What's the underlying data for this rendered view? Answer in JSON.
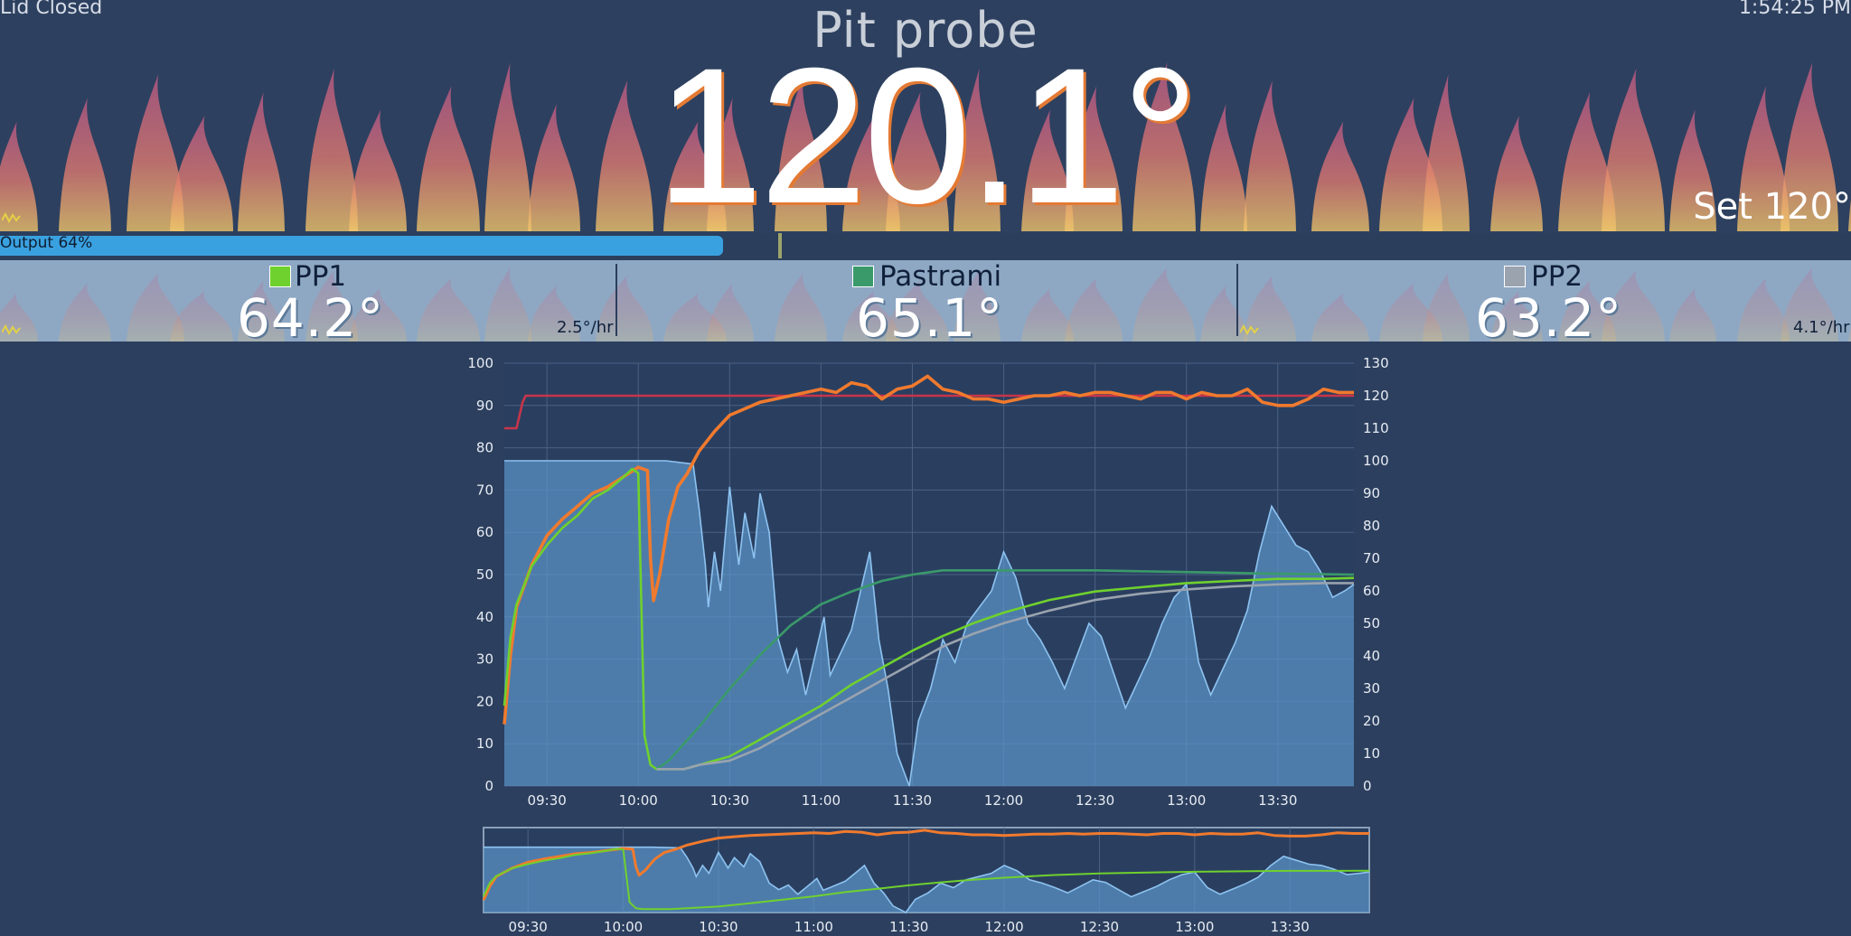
{
  "header": {
    "lid_status": "Lid Closed",
    "clock": "1:54:25 PM",
    "pit_name": "Pit probe",
    "pit_temp": "120.1°",
    "setpoint": "Set 120°",
    "output_label": "Output 64%",
    "output_percent": 64
  },
  "probes": [
    {
      "name": "PP1",
      "temp": "64.2°",
      "rate": "2.5°/hr",
      "color": "#6fd12d"
    },
    {
      "name": "Pastrami",
      "temp": "65.1°",
      "rate": "",
      "color": "#3a9a6a"
    },
    {
      "name": "PP2",
      "temp": "63.2°",
      "rate": "4.1°/hr",
      "color": "#9aa3ae"
    }
  ],
  "colors": {
    "background": "#2c3f5e",
    "pit_line": "#f07a2e",
    "setpoint_line": "#c8344a",
    "fan_area": "#5b94c8"
  },
  "chart_data": [
    {
      "type": "line",
      "title": "",
      "left_axis": {
        "ylim": [
          0,
          100
        ],
        "ticks": [
          0,
          10,
          20,
          30,
          40,
          50,
          60,
          70,
          80,
          90,
          100
        ]
      },
      "right_axis": {
        "ylim": [
          0,
          130
        ],
        "ticks": [
          0,
          10,
          20,
          30,
          40,
          50,
          60,
          70,
          80,
          90,
          100,
          110,
          120,
          130
        ]
      },
      "x_ticks": [
        "09:30",
        "10:00",
        "10:30",
        "11:00",
        "11:30",
        "12:00",
        "12:30",
        "13:00",
        "13:30"
      ],
      "xlim": [
        "09:16",
        "13:55"
      ],
      "grid": true,
      "series": [
        {
          "axis": "right",
          "color": "#5b94c8",
          "area": true,
          "x": [
            "09:16",
            "10:09",
            "10:18",
            "10:20",
            "10:22",
            "10:23",
            "10:25",
            "10:27",
            "10:30",
            "10:33",
            "10:35",
            "10:38",
            "10:40",
            "10:43",
            "10:46",
            "10:49",
            "10:52",
            "10:55",
            "10:58",
            "11:01",
            "11:03",
            "11:06",
            "11:10",
            "11:13",
            "11:16",
            "11:19",
            "11:22",
            "11:25",
            "11:29",
            "11:32",
            "11:36",
            "11:40",
            "11:44",
            "11:48",
            "11:52",
            "11:56",
            "12:00",
            "12:04",
            "12:08",
            "12:12",
            "12:16",
            "12:20",
            "12:24",
            "12:28",
            "12:32",
            "12:36",
            "12:40",
            "12:44",
            "12:48",
            "12:52",
            "12:56",
            "13:00",
            "13:04",
            "13:08",
            "13:12",
            "13:16",
            "13:20",
            "13:24",
            "13:28",
            "13:32",
            "13:36",
            "13:40",
            "13:44",
            "13:48",
            "13:52",
            "13:55"
          ],
          "values": [
            100,
            100,
            99,
            85,
            68,
            55,
            72,
            60,
            92,
            68,
            84,
            70,
            90,
            78,
            45,
            35,
            42,
            28,
            40,
            52,
            34,
            40,
            48,
            60,
            72,
            45,
            30,
            10,
            0,
            20,
            30,
            45,
            38,
            50,
            55,
            60,
            72,
            64,
            50,
            45,
            38,
            30,
            40,
            50,
            46,
            35,
            24,
            32,
            40,
            50,
            58,
            62,
            38,
            28,
            36,
            44,
            54,
            72,
            86,
            80,
            74,
            72,
            66,
            58,
            60,
            62
          ]
        },
        {
          "axis": "right",
          "color": "#c8344a",
          "x": [
            "09:16",
            "09:20",
            "09:22",
            "09:23",
            "13:55"
          ],
          "values": [
            110,
            110,
            118,
            120,
            120
          ]
        },
        {
          "axis": "right",
          "color": "#f07a2e",
          "x": [
            "09:16",
            "09:18",
            "09:20",
            "09:25",
            "09:30",
            "09:35",
            "09:40",
            "09:45",
            "09:50",
            "09:55",
            "10:00",
            "10:03",
            "10:04",
            "10:05",
            "10:07",
            "10:10",
            "10:13",
            "10:16",
            "10:20",
            "10:25",
            "10:30",
            "10:35",
            "10:40",
            "10:45",
            "10:50",
            "10:55",
            "11:00",
            "11:05",
            "11:10",
            "11:15",
            "11:20",
            "11:25",
            "11:30",
            "11:35",
            "11:40",
            "11:45",
            "11:50",
            "11:55",
            "12:00",
            "12:05",
            "12:10",
            "12:15",
            "12:20",
            "12:25",
            "12:30",
            "12:35",
            "12:40",
            "12:45",
            "12:50",
            "12:55",
            "13:00",
            "13:05",
            "13:10",
            "13:15",
            "13:20",
            "13:25",
            "13:30",
            "13:35",
            "13:40",
            "13:45",
            "13:50",
            "13:55"
          ],
          "values": [
            19,
            40,
            55,
            68,
            77,
            82,
            86,
            90,
            92,
            95,
            98,
            97,
            70,
            57,
            65,
            82,
            92,
            96,
            103,
            109,
            114,
            116,
            118,
            119,
            120,
            121,
            122,
            121,
            124,
            123,
            119,
            122,
            123,
            126,
            122,
            121,
            119,
            119,
            118,
            119,
            120,
            120,
            121,
            120,
            121,
            121,
            120,
            119,
            121,
            121,
            119,
            121,
            120,
            120,
            122,
            118,
            117,
            117,
            119,
            122,
            121,
            121
          ]
        },
        {
          "axis": "left",
          "color": "#6fd12d",
          "x": [
            "09:16",
            "09:18",
            "09:20",
            "09:25",
            "09:30",
            "09:35",
            "09:40",
            "09:45",
            "09:50",
            "09:55",
            "09:58",
            "10:00",
            "10:02",
            "10:04",
            "10:06",
            "10:08",
            "10:15",
            "10:20",
            "10:30",
            "10:40",
            "10:50",
            "11:00",
            "11:10",
            "11:20",
            "11:30",
            "11:40",
            "11:50",
            "12:00",
            "12:15",
            "12:30",
            "12:45",
            "13:00",
            "13:15",
            "13:30",
            "13:45",
            "13:55"
          ],
          "values": [
            19,
            35,
            43,
            52,
            57,
            61,
            64,
            68,
            70,
            73,
            75,
            74,
            12,
            5,
            4,
            4,
            4,
            5,
            7,
            11,
            15,
            19,
            24,
            28,
            32,
            35.5,
            38.5,
            41,
            44,
            46,
            47,
            48,
            48.5,
            49,
            49,
            49.2
          ]
        },
        {
          "axis": "left",
          "color": "#3a9a6a",
          "x": [
            "10:06",
            "10:10",
            "10:20",
            "10:30",
            "10:40",
            "10:50",
            "11:00",
            "11:10",
            "11:20",
            "11:30",
            "11:40",
            "11:50",
            "12:00",
            "12:15",
            "12:30",
            "12:45",
            "13:00",
            "13:15",
            "13:30",
            "13:45",
            "13:55"
          ],
          "values": [
            4,
            6,
            14,
            23,
            31,
            38,
            43,
            46,
            48.5,
            50,
            51,
            51,
            51,
            51,
            51,
            50.8,
            50.6,
            50.4,
            50.2,
            50.1,
            50
          ]
        },
        {
          "axis": "left",
          "color": "#9aa3ae",
          "x": [
            "10:06",
            "10:15",
            "10:20",
            "10:30",
            "10:40",
            "10:50",
            "11:00",
            "11:10",
            "11:20",
            "11:30",
            "11:40",
            "11:50",
            "12:00",
            "12:15",
            "12:30",
            "12:45",
            "13:00",
            "13:15",
            "13:30",
            "13:45",
            "13:55"
          ],
          "values": [
            4,
            4,
            5,
            6,
            9,
            13,
            17,
            21,
            25,
            29,
            33,
            36,
            38.5,
            41.5,
            44,
            45.5,
            46.5,
            47.2,
            47.7,
            48,
            48
          ]
        }
      ]
    },
    {
      "type": "line",
      "title": "",
      "role": "navigator",
      "x_ticks": [
        "09:30",
        "10:00",
        "10:30",
        "11:00",
        "11:30",
        "12:00",
        "12:30",
        "13:00",
        "13:30"
      ],
      "xlim": [
        "09:16",
        "13:55"
      ],
      "series": [
        {
          "color": "#5b94c8",
          "area": true,
          "same_as_main": true
        },
        {
          "color": "#f07a2e",
          "same_as_main": true
        },
        {
          "color": "#6fd12d",
          "same_as_main": true
        }
      ]
    }
  ]
}
